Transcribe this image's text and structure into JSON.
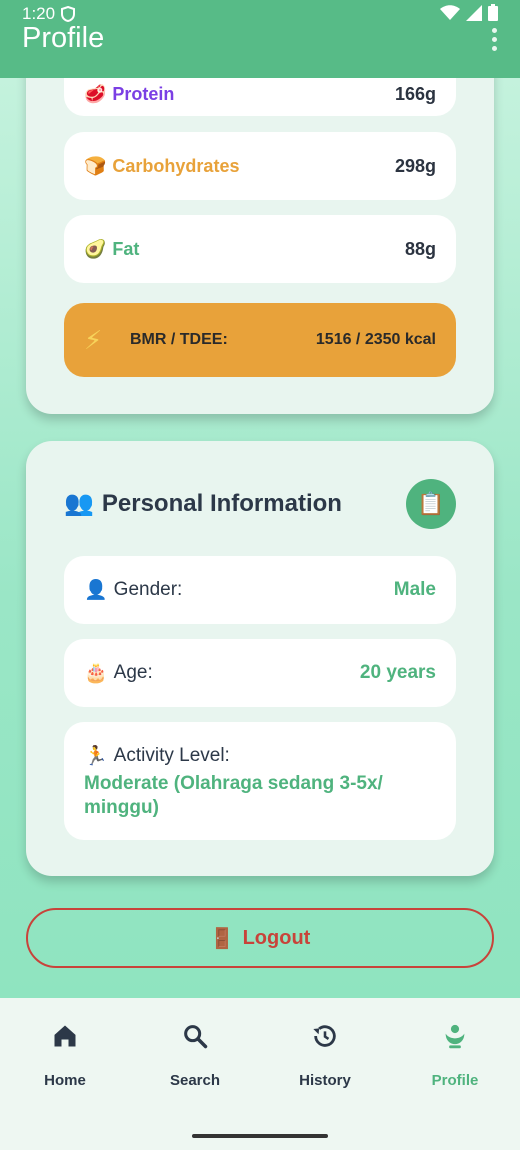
{
  "status": {
    "time": "1:20"
  },
  "appbar": {
    "title": "Profile"
  },
  "macros": [
    {
      "icon": "🥩",
      "label": "Protein",
      "value": "166g",
      "color": "#7b3fe4"
    },
    {
      "icon": "🍞",
      "label": "Carbohydrates",
      "value": "298g",
      "color": "#e8a23a"
    },
    {
      "icon": "🥑",
      "label": "Fat",
      "value": "88g",
      "color": "#4fb37e"
    }
  ],
  "bmr": {
    "icon": "⚡",
    "label": "BMR / TDEE:",
    "value": "1516 / 2350 kcal"
  },
  "personal": {
    "icon": "👥",
    "title": "Personal Information",
    "clip_icon": "📋",
    "gender": {
      "icon": "👤",
      "label": "Gender:",
      "value": "Male"
    },
    "age": {
      "icon": "🎂",
      "label": "Age:",
      "value": "20 years"
    },
    "activity": {
      "icon": "🏃",
      "label": "Activity Level:",
      "value": "Moderate (Olahraga sedang 3-5x/ minggu)"
    }
  },
  "logout": {
    "icon": "🚪",
    "label": "Logout"
  },
  "nav": {
    "home": "Home",
    "search": "Search",
    "history": "History",
    "profile": "Profile"
  },
  "colors": {
    "primary": "#57bb87",
    "accent": "#4fb37e",
    "warning": "#e8a23a",
    "danger": "#c8433a"
  }
}
